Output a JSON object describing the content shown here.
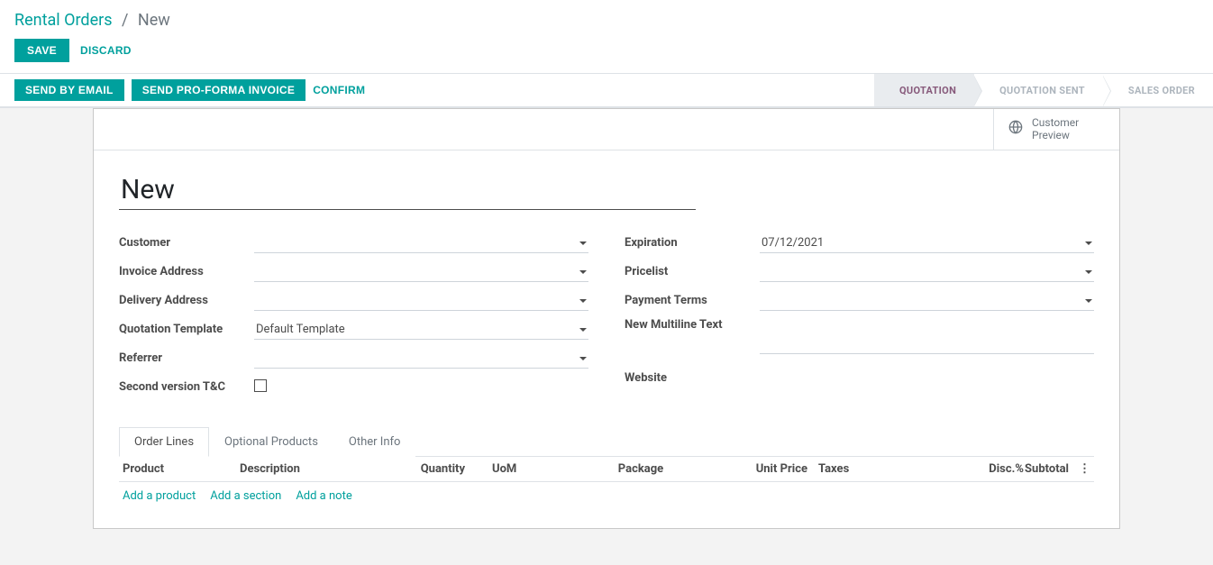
{
  "breadcrumb": {
    "root": "Rental Orders",
    "current": "New"
  },
  "toolbar": {
    "save": "SAVE",
    "discard": "DISCARD"
  },
  "actions": {
    "send_email": "SEND BY EMAIL",
    "send_proforma": "SEND PRO-FORMA INVOICE",
    "confirm": "CONFIRM"
  },
  "status": {
    "quotation": "QUOTATION",
    "quotation_sent": "QUOTATION SENT",
    "sales_order": "SALES ORDER"
  },
  "stat": {
    "customer_preview_l1": "Customer",
    "customer_preview_l2": "Preview"
  },
  "title": "New",
  "labels": {
    "customer": "Customer",
    "invoice_address": "Invoice Address",
    "delivery_address": "Delivery Address",
    "quotation_template": "Quotation Template",
    "referrer": "Referrer",
    "tandc": "Second version T&C",
    "expiration": "Expiration",
    "pricelist": "Pricelist",
    "payment_terms": "Payment Terms",
    "multiline": "New Multiline Text",
    "website": "Website"
  },
  "values": {
    "quotation_template": "Default Template",
    "expiration": "07/12/2021"
  },
  "tabs": {
    "order_lines": "Order Lines",
    "optional": "Optional Products",
    "other": "Other Info"
  },
  "cols": {
    "product": "Product",
    "description": "Description",
    "quantity": "Quantity",
    "uom": "UoM",
    "package": "Package",
    "unit_price": "Unit Price",
    "taxes": "Taxes",
    "disc": "Disc.%",
    "subtotal": "Subtotal",
    "menu": "⋮"
  },
  "addrow": {
    "product": "Add a product",
    "section": "Add a section",
    "note": "Add a note"
  }
}
